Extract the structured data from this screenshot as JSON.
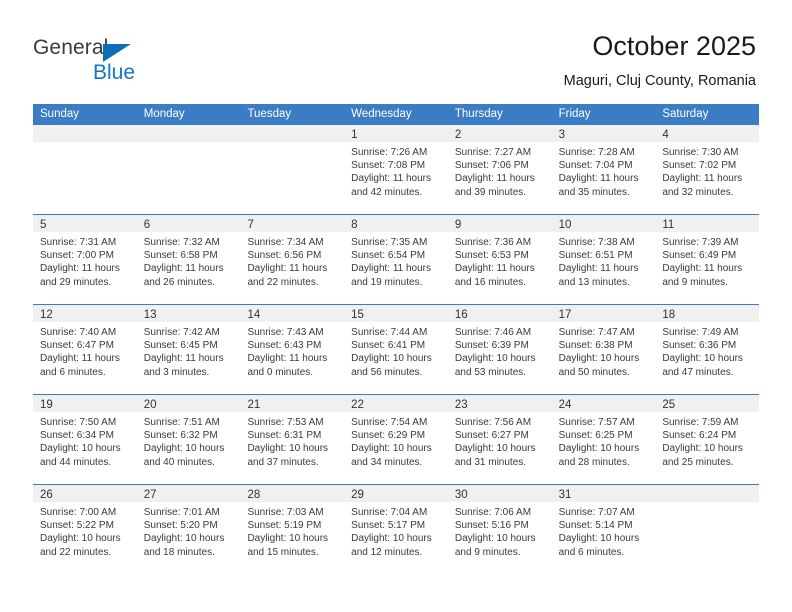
{
  "brand": {
    "name_top": "General",
    "name_bottom": "Blue"
  },
  "header": {
    "title": "October 2025",
    "subtitle": "Maguri, Cluj County, Romania"
  },
  "colors": {
    "header_blue": "#3b7dc4",
    "logo_blue": "#1476c4",
    "daynum_band": "#f0f0f0",
    "text": "#3a3a3a"
  },
  "labels": {
    "sunrise": "Sunrise:",
    "sunset": "Sunset:",
    "daylight": "Daylight:"
  },
  "weekdays": [
    "Sunday",
    "Monday",
    "Tuesday",
    "Wednesday",
    "Thursday",
    "Friday",
    "Saturday"
  ],
  "weeks": [
    [
      {
        "day": "",
        "empty": true
      },
      {
        "day": "",
        "empty": true
      },
      {
        "day": "",
        "empty": true
      },
      {
        "day": "1",
        "sunrise": "Sunrise: 7:26 AM",
        "sunset": "Sunset: 7:08 PM",
        "daylight1": "Daylight: 11 hours",
        "daylight2": "and 42 minutes."
      },
      {
        "day": "2",
        "sunrise": "Sunrise: 7:27 AM",
        "sunset": "Sunset: 7:06 PM",
        "daylight1": "Daylight: 11 hours",
        "daylight2": "and 39 minutes."
      },
      {
        "day": "3",
        "sunrise": "Sunrise: 7:28 AM",
        "sunset": "Sunset: 7:04 PM",
        "daylight1": "Daylight: 11 hours",
        "daylight2": "and 35 minutes."
      },
      {
        "day": "4",
        "sunrise": "Sunrise: 7:30 AM",
        "sunset": "Sunset: 7:02 PM",
        "daylight1": "Daylight: 11 hours",
        "daylight2": "and 32 minutes."
      }
    ],
    [
      {
        "day": "5",
        "sunrise": "Sunrise: 7:31 AM",
        "sunset": "Sunset: 7:00 PM",
        "daylight1": "Daylight: 11 hours",
        "daylight2": "and 29 minutes."
      },
      {
        "day": "6",
        "sunrise": "Sunrise: 7:32 AM",
        "sunset": "Sunset: 6:58 PM",
        "daylight1": "Daylight: 11 hours",
        "daylight2": "and 26 minutes."
      },
      {
        "day": "7",
        "sunrise": "Sunrise: 7:34 AM",
        "sunset": "Sunset: 6:56 PM",
        "daylight1": "Daylight: 11 hours",
        "daylight2": "and 22 minutes."
      },
      {
        "day": "8",
        "sunrise": "Sunrise: 7:35 AM",
        "sunset": "Sunset: 6:54 PM",
        "daylight1": "Daylight: 11 hours",
        "daylight2": "and 19 minutes."
      },
      {
        "day": "9",
        "sunrise": "Sunrise: 7:36 AM",
        "sunset": "Sunset: 6:53 PM",
        "daylight1": "Daylight: 11 hours",
        "daylight2": "and 16 minutes."
      },
      {
        "day": "10",
        "sunrise": "Sunrise: 7:38 AM",
        "sunset": "Sunset: 6:51 PM",
        "daylight1": "Daylight: 11 hours",
        "daylight2": "and 13 minutes."
      },
      {
        "day": "11",
        "sunrise": "Sunrise: 7:39 AM",
        "sunset": "Sunset: 6:49 PM",
        "daylight1": "Daylight: 11 hours",
        "daylight2": "and 9 minutes."
      }
    ],
    [
      {
        "day": "12",
        "sunrise": "Sunrise: 7:40 AM",
        "sunset": "Sunset: 6:47 PM",
        "daylight1": "Daylight: 11 hours",
        "daylight2": "and 6 minutes."
      },
      {
        "day": "13",
        "sunrise": "Sunrise: 7:42 AM",
        "sunset": "Sunset: 6:45 PM",
        "daylight1": "Daylight: 11 hours",
        "daylight2": "and 3 minutes."
      },
      {
        "day": "14",
        "sunrise": "Sunrise: 7:43 AM",
        "sunset": "Sunset: 6:43 PM",
        "daylight1": "Daylight: 11 hours",
        "daylight2": "and 0 minutes."
      },
      {
        "day": "15",
        "sunrise": "Sunrise: 7:44 AM",
        "sunset": "Sunset: 6:41 PM",
        "daylight1": "Daylight: 10 hours",
        "daylight2": "and 56 minutes."
      },
      {
        "day": "16",
        "sunrise": "Sunrise: 7:46 AM",
        "sunset": "Sunset: 6:39 PM",
        "daylight1": "Daylight: 10 hours",
        "daylight2": "and 53 minutes."
      },
      {
        "day": "17",
        "sunrise": "Sunrise: 7:47 AM",
        "sunset": "Sunset: 6:38 PM",
        "daylight1": "Daylight: 10 hours",
        "daylight2": "and 50 minutes."
      },
      {
        "day": "18",
        "sunrise": "Sunrise: 7:49 AM",
        "sunset": "Sunset: 6:36 PM",
        "daylight1": "Daylight: 10 hours",
        "daylight2": "and 47 minutes."
      }
    ],
    [
      {
        "day": "19",
        "sunrise": "Sunrise: 7:50 AM",
        "sunset": "Sunset: 6:34 PM",
        "daylight1": "Daylight: 10 hours",
        "daylight2": "and 44 minutes."
      },
      {
        "day": "20",
        "sunrise": "Sunrise: 7:51 AM",
        "sunset": "Sunset: 6:32 PM",
        "daylight1": "Daylight: 10 hours",
        "daylight2": "and 40 minutes."
      },
      {
        "day": "21",
        "sunrise": "Sunrise: 7:53 AM",
        "sunset": "Sunset: 6:31 PM",
        "daylight1": "Daylight: 10 hours",
        "daylight2": "and 37 minutes."
      },
      {
        "day": "22",
        "sunrise": "Sunrise: 7:54 AM",
        "sunset": "Sunset: 6:29 PM",
        "daylight1": "Daylight: 10 hours",
        "daylight2": "and 34 minutes."
      },
      {
        "day": "23",
        "sunrise": "Sunrise: 7:56 AM",
        "sunset": "Sunset: 6:27 PM",
        "daylight1": "Daylight: 10 hours",
        "daylight2": "and 31 minutes."
      },
      {
        "day": "24",
        "sunrise": "Sunrise: 7:57 AM",
        "sunset": "Sunset: 6:25 PM",
        "daylight1": "Daylight: 10 hours",
        "daylight2": "and 28 minutes."
      },
      {
        "day": "25",
        "sunrise": "Sunrise: 7:59 AM",
        "sunset": "Sunset: 6:24 PM",
        "daylight1": "Daylight: 10 hours",
        "daylight2": "and 25 minutes."
      }
    ],
    [
      {
        "day": "26",
        "sunrise": "Sunrise: 7:00 AM",
        "sunset": "Sunset: 5:22 PM",
        "daylight1": "Daylight: 10 hours",
        "daylight2": "and 22 minutes."
      },
      {
        "day": "27",
        "sunrise": "Sunrise: 7:01 AM",
        "sunset": "Sunset: 5:20 PM",
        "daylight1": "Daylight: 10 hours",
        "daylight2": "and 18 minutes."
      },
      {
        "day": "28",
        "sunrise": "Sunrise: 7:03 AM",
        "sunset": "Sunset: 5:19 PM",
        "daylight1": "Daylight: 10 hours",
        "daylight2": "and 15 minutes."
      },
      {
        "day": "29",
        "sunrise": "Sunrise: 7:04 AM",
        "sunset": "Sunset: 5:17 PM",
        "daylight1": "Daylight: 10 hours",
        "daylight2": "and 12 minutes."
      },
      {
        "day": "30",
        "sunrise": "Sunrise: 7:06 AM",
        "sunset": "Sunset: 5:16 PM",
        "daylight1": "Daylight: 10 hours",
        "daylight2": "and 9 minutes."
      },
      {
        "day": "31",
        "sunrise": "Sunrise: 7:07 AM",
        "sunset": "Sunset: 5:14 PM",
        "daylight1": "Daylight: 10 hours",
        "daylight2": "and 6 minutes."
      },
      {
        "day": "",
        "empty": true
      }
    ]
  ]
}
